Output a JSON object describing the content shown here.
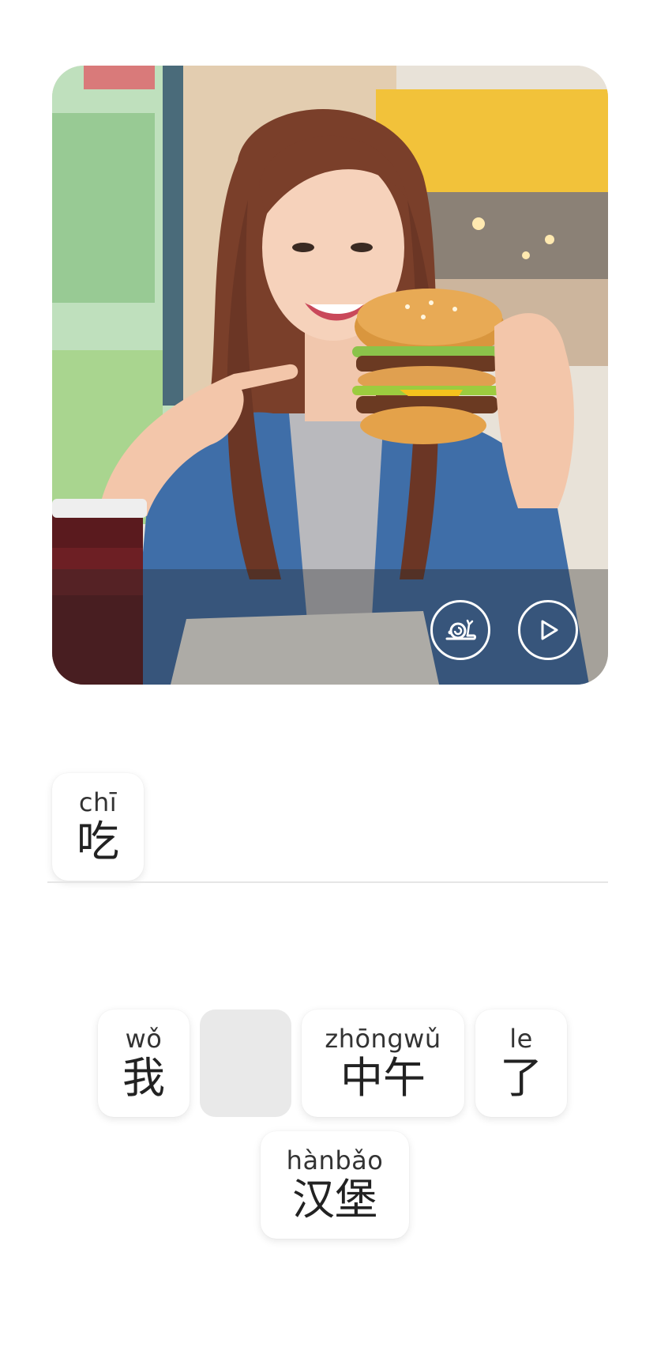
{
  "photo": {
    "alt_icon": "photo-woman-holding-burger",
    "controls": {
      "slow_audio_icon": "snail-icon",
      "play_audio_icon": "play-icon"
    }
  },
  "answer": {
    "tiles": [
      {
        "pinyin": "chī",
        "hanzi": "吃"
      }
    ]
  },
  "word_bank": {
    "tiles": [
      {
        "pinyin": "wǒ",
        "hanzi": "我",
        "used": false
      },
      {
        "pinyin": "",
        "hanzi": "",
        "used": true
      },
      {
        "pinyin": "zhōngwǔ",
        "hanzi": "中午",
        "used": false
      },
      {
        "pinyin": "le",
        "hanzi": "了",
        "used": false
      },
      {
        "pinyin": "hànbǎo",
        "hanzi": "汉堡",
        "used": false
      }
    ]
  },
  "colors": {
    "tile_bg": "#ffffff",
    "used_tile_bg": "#e9e9e9",
    "divider": "#e6e6e6"
  }
}
